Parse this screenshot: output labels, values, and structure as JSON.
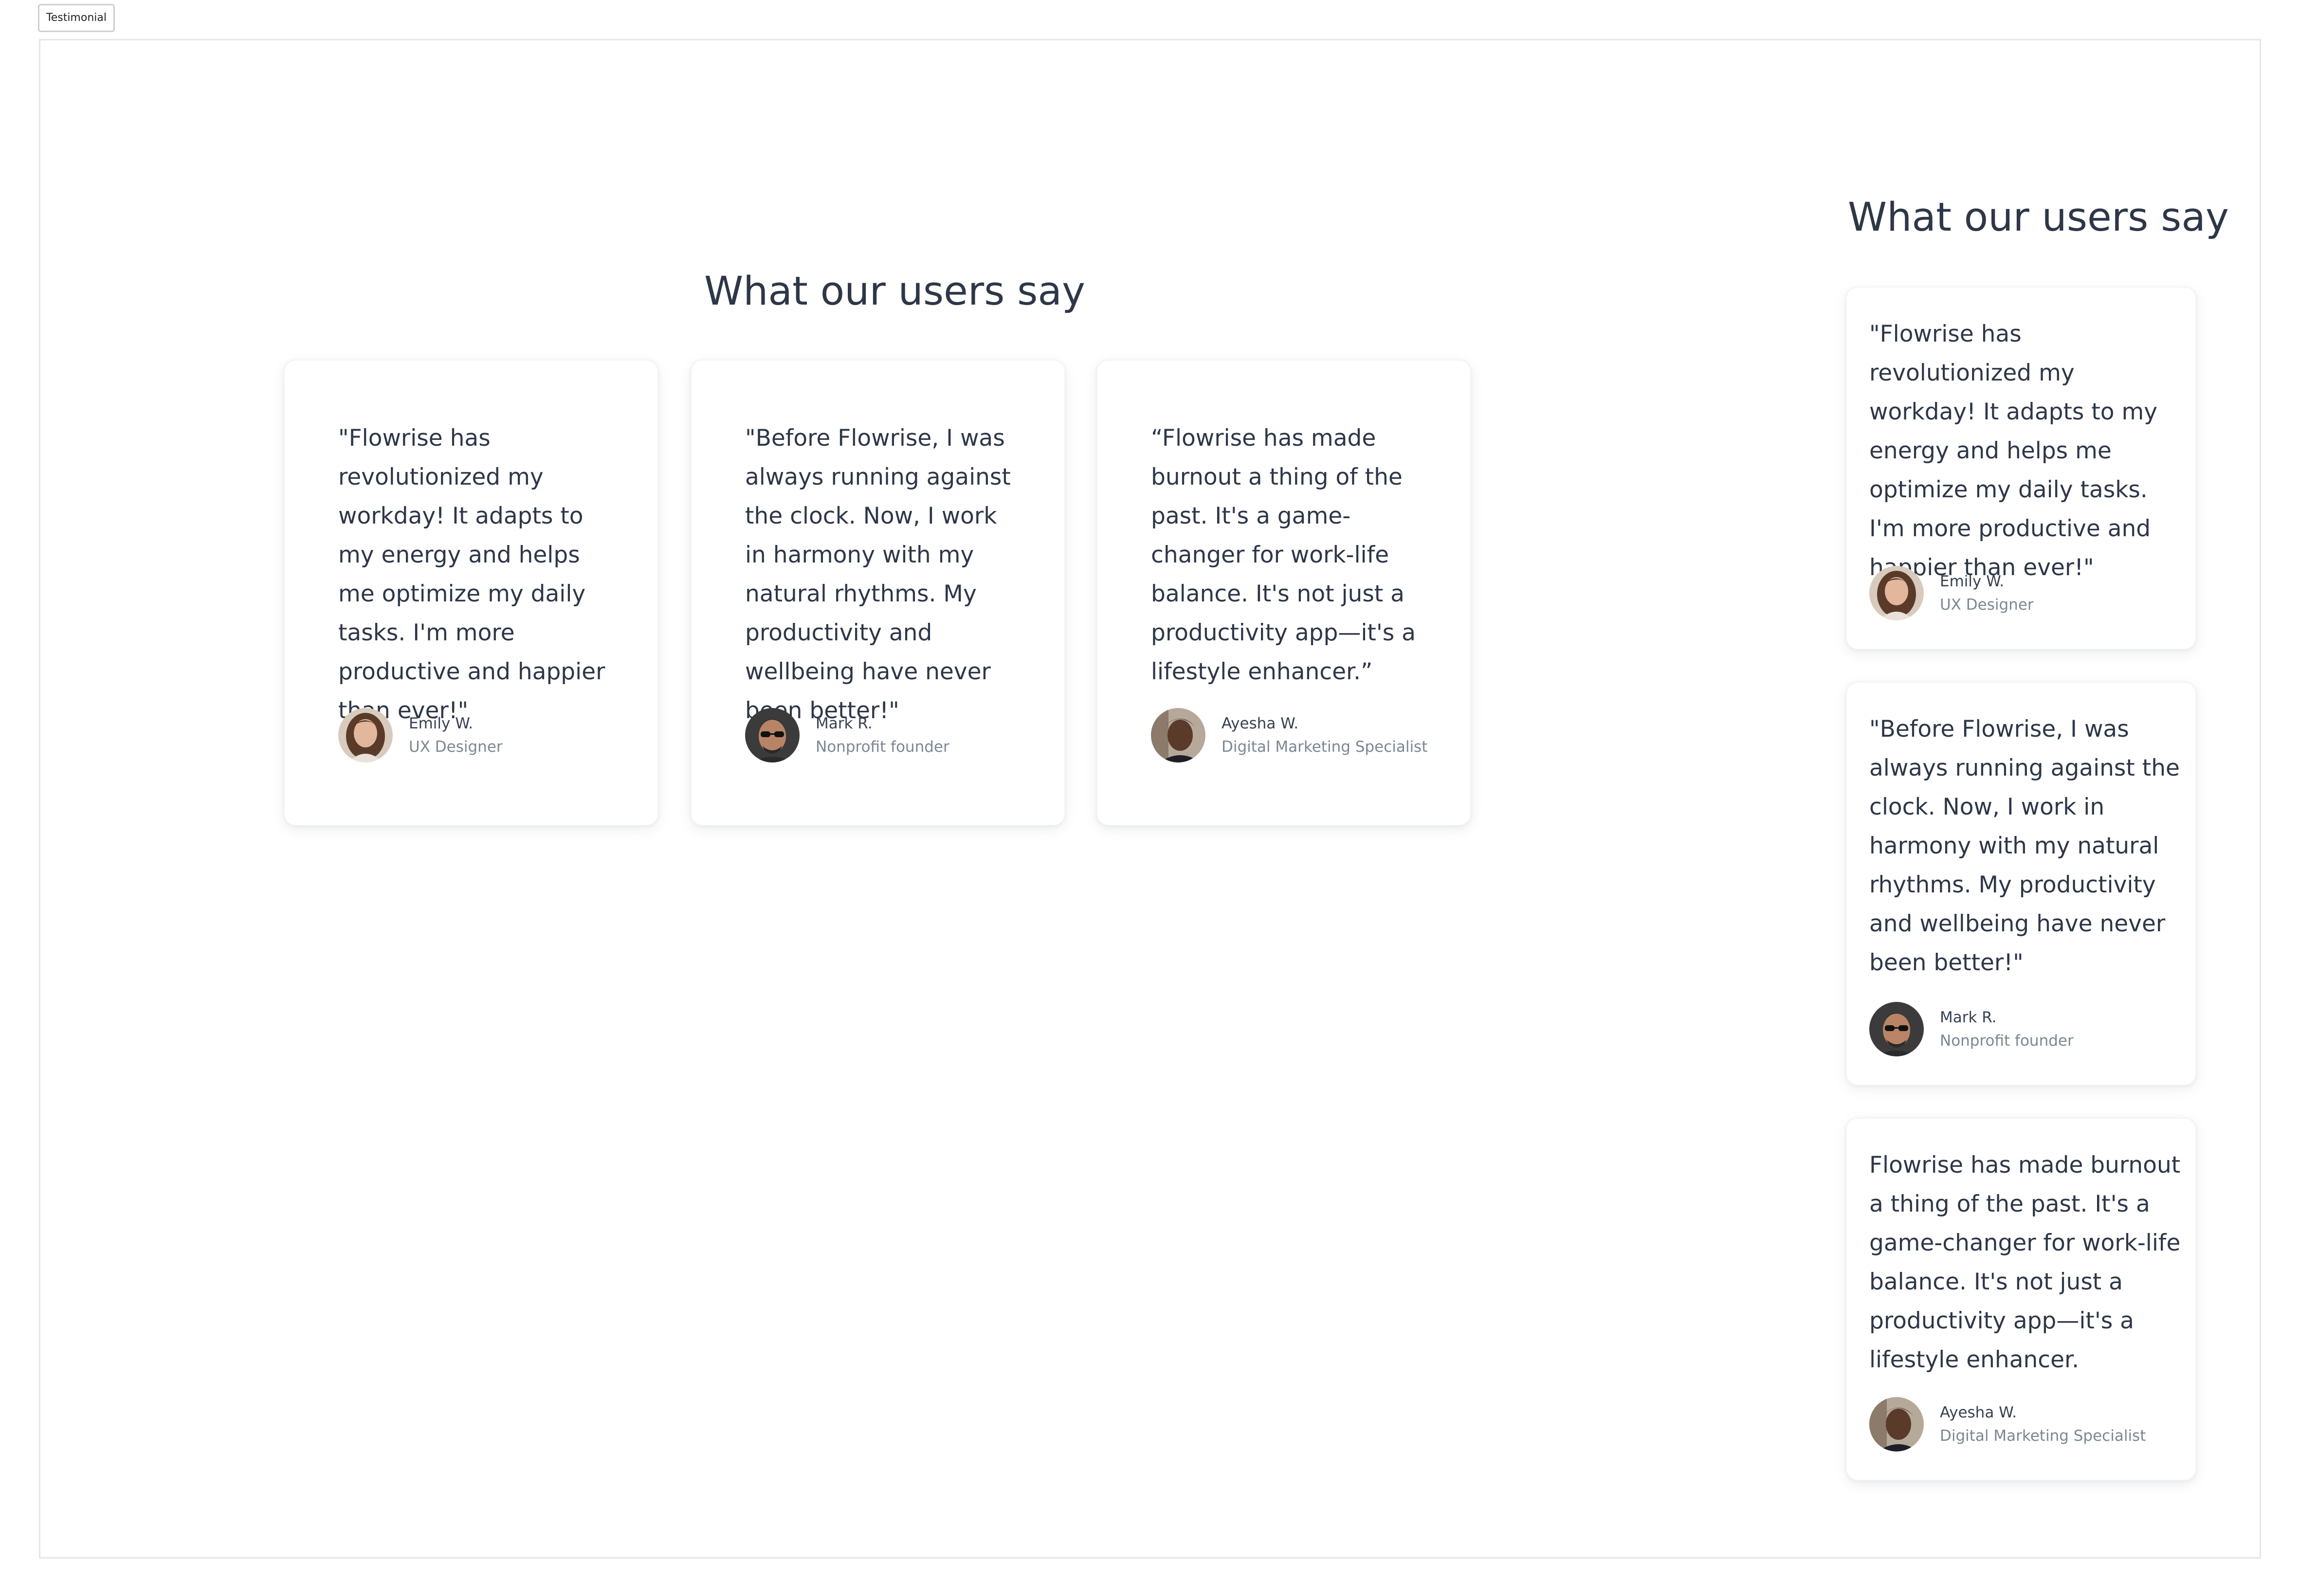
{
  "frame": {
    "label": "Testimonial"
  },
  "heading": "What our users say",
  "testimonials_row": [
    {
      "quote": "\"Flowrise has revolutionized my workday! It adapts to my energy and helps me optimize my daily tasks. I'm more productive and happier than ever!\"",
      "name": "Emily W.",
      "role": "UX Designer"
    },
    {
      "quote": "\"Before Flowrise, I was always running against the clock. Now, I work in harmony with my natural rhythms. My productivity and wellbeing have never been better!\"",
      "name": "Mark R.",
      "role": "Nonprofit founder"
    },
    {
      "quote": "“Flowrise has made burnout a thing of the past. It's a game-changer for work-life balance. It's not just a productivity app—it's a lifestyle enhancer.”",
      "name": "Ayesha W.",
      "role": "Digital Marketing Specialist"
    }
  ],
  "testimonials_column": [
    {
      "quote": "\"Flowrise has revolutionized my workday! It adapts to my energy and helps me optimize my daily tasks. I'm more productive and happier than ever!\"",
      "name": "Emily W.",
      "role": "UX Designer"
    },
    {
      "quote": "\"Before Flowrise, I was always running against the clock. Now, I work in harmony with my natural rhythms. My productivity and wellbeing have never been better!\"",
      "name": "Mark R.",
      "role": "Nonprofit founder"
    },
    {
      "quote": "Flowrise has made burnout a thing of the past. It's a game-changer for work-life balance. It's not just a productivity app—it's a lifestyle enhancer.",
      "name": "Ayesha W.",
      "role": "Digital Marketing Specialist"
    }
  ],
  "colors": {
    "heading": "#2d3748",
    "text": "#2d3748",
    "muted": "#7b8794",
    "card_bg": "#ffffff",
    "frame_border": "#e6e6e6"
  }
}
